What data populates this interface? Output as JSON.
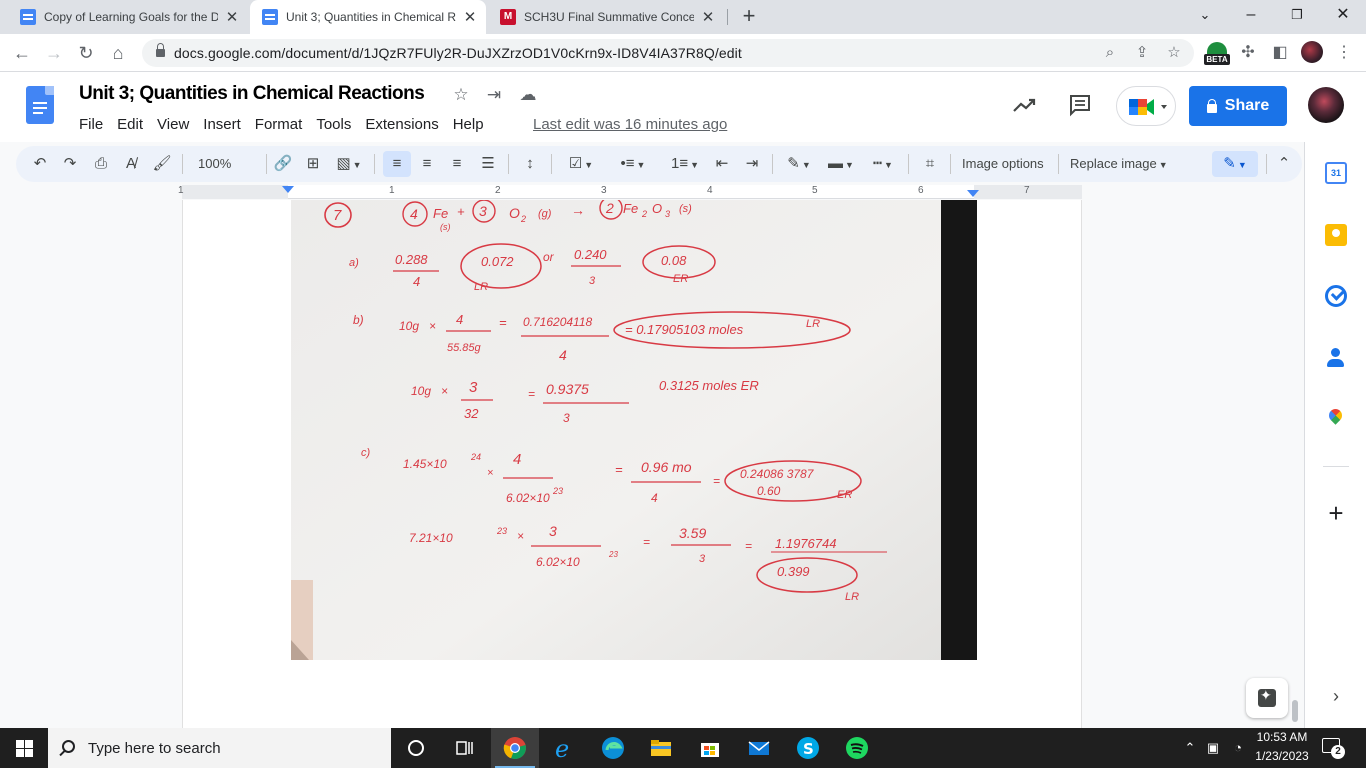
{
  "browser": {
    "tabs": [
      {
        "title": "Copy of Learning Goals for the D",
        "favicon": "google-docs-icon",
        "active": false
      },
      {
        "title": "Unit 3; Quantities in Chemical Re",
        "favicon": "google-docs-icon",
        "active": true
      },
      {
        "title": "SCH3U Final Summative Concept",
        "favicon": "mcgraw-hill-icon",
        "active": false
      }
    ],
    "url": "docs.google.com/document/d/1JQzR7FUly2R-DuJXZrzOD1V0cKrn9x-ID8V4IA37R8Q/edit",
    "beta_badge": "BETA"
  },
  "docs": {
    "title": "Unit 3; Quantities in Chemical Reactions",
    "menu": [
      "File",
      "Edit",
      "View",
      "Insert",
      "Format",
      "Tools",
      "Extensions",
      "Help"
    ],
    "last_edit": "Last edit was 16 minutes ago",
    "share_label": "Share",
    "colors": {
      "share": "#1a73e8",
      "toolbar_bg": "#edf2fa",
      "ink": "#d83a44"
    }
  },
  "toolbar": {
    "zoom": "100%",
    "image_options": "Image options",
    "replace_image": "Replace image"
  },
  "ruler": {
    "numbers": [
      "1",
      "1",
      "2",
      "3",
      "4",
      "5",
      "6",
      "7"
    ]
  },
  "worksheet": {
    "q_number": "7",
    "equation": [
      "4",
      "Fe",
      "(s)",
      "+",
      "3",
      "O",
      "2",
      "(g)",
      "→",
      "2",
      "Fe",
      "2",
      "O",
      "3",
      "(s)"
    ],
    "a": {
      "label": "a)",
      "fe_num": "0.288",
      "fe_den": "4",
      "fe_res": "0.072",
      "fe_tag": "LR",
      "or": "or",
      "o2_num": "0.240",
      "o2_den": "3",
      "o2_res": "0.08",
      "o2_tag": "ER"
    },
    "b": {
      "label": "b)",
      "l1_mass": "10g",
      "l1_x": "×",
      "l1_coef": "4",
      "l1_mm": "55.85g",
      "l1_eq": "=",
      "l1_val": "0.716204118",
      "l1_val_den": "4",
      "l1_res": "= 0.17905103 moles",
      "l1_tag": "LR",
      "l2_mass": "10g",
      "l2_x": "×",
      "l2_coef": "3",
      "l2_mm": "32",
      "l2_eq": "=",
      "l2_val": "0.9375",
      "l2_val_den": "3",
      "l2_res": "0.3125 moles ER"
    },
    "c": {
      "label": "c)",
      "l1_n": "1.45×10",
      "l1_exp": "24",
      "l1_x": "×",
      "l1_coef": "4",
      "l1_av": "6.02×10",
      "l1_av_exp": "23",
      "l1_eq": "=",
      "l1_mol": "0.96 mo",
      "l1_den": "4",
      "l1_eq2": "=",
      "l1_res": "0.24086 3787",
      "l1_res2": "0.60",
      "l1_tag": "ER",
      "l2_n": "7.21×10",
      "l2_exp": "23",
      "l2_x": "×",
      "l2_coef": "3",
      "l2_av": "6.02×10",
      "l2_av_exp": "23",
      "l2_eq": "=",
      "l2_mol": "3.59",
      "l2_den": "3",
      "l2_eq2": "=",
      "l2_res": "1.1976744",
      "l2_res2": "0.399",
      "l2_tag": "LR"
    }
  },
  "side_panel": {
    "calendar_day": "31"
  },
  "taskbar": {
    "search_placeholder": "Type here to search",
    "time": "10:53 AM",
    "date": "1/23/2023",
    "notifications": "2"
  }
}
